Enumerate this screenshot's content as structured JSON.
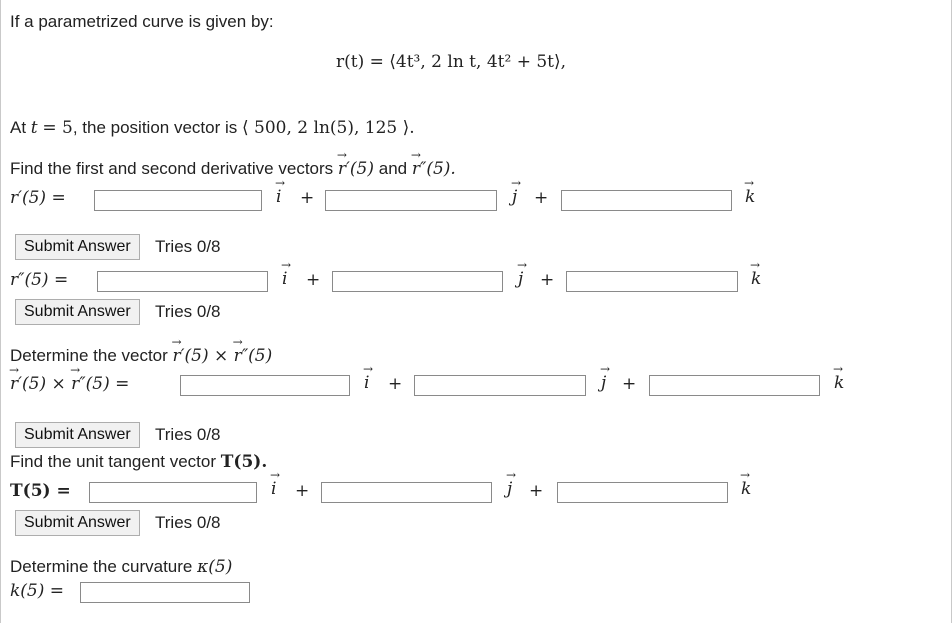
{
  "intro": "If a parametrized curve is given by:",
  "curve_eq": "r(t) = ⟨4t³, 2 ln t, 4t² + 5t⟩,",
  "position": {
    "prefix": "At",
    "mid": ", the position vector is",
    "var": "t",
    "eq": "= 5",
    "value": "⟨ 500, 2 ln(5), 125 ⟩."
  },
  "derivs": {
    "prompt_prefix": "Find the first and second derivative vectors",
    "prompt_and": "and",
    "first_label": "r′(5) =",
    "second_label": "r″(5) ="
  },
  "cross": {
    "prompt": "Determine the vector",
    "expr": "r′(5) × r″(5)",
    "label": "r′(5) × r″(5) ="
  },
  "tangent": {
    "prompt": "Find the unit tangent vector",
    "expr": "T(5).",
    "label": "T(5) ="
  },
  "curvature": {
    "prompt": "Determine the curvature",
    "expr": "κ(5)",
    "label": "k(5) ="
  },
  "units": {
    "i": "i",
    "j": "j",
    "k": "k",
    "plus": "+"
  },
  "submit_label": "Submit Answer",
  "tries": "Tries 0/8"
}
